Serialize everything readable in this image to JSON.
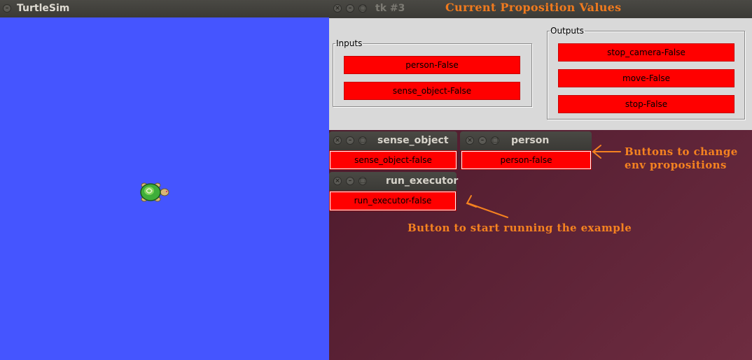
{
  "turtlesim": {
    "title": "TurtleSim",
    "background_color": "#4555ff",
    "turtle_icon": "turtle-icon"
  },
  "tk_window": {
    "title": "tk #3",
    "heading": "Current Proposition Values",
    "inputs": {
      "legend": "Inputs",
      "buttons": [
        "person-False",
        "sense_object-False"
      ]
    },
    "outputs": {
      "legend": "Outputs",
      "buttons": [
        "stop_camera-False",
        "move-False",
        "stop-False"
      ]
    }
  },
  "sense_object_window": {
    "title": "sense_object",
    "button": "sense_object-false"
  },
  "person_window": {
    "title": "person",
    "button": "person-false"
  },
  "run_executor_window": {
    "title": "run_executor",
    "button": "run_executor-false"
  },
  "annotations": {
    "env_buttons_line1": "Buttons to change",
    "env_buttons_line2": "env propositions",
    "start_button": "Button to start running the example"
  },
  "colors": {
    "button_red": "#ff0000",
    "annotation_orange": "#f58220",
    "heading_orange": "#f07a1e",
    "desktop": "#4e1a2c"
  }
}
